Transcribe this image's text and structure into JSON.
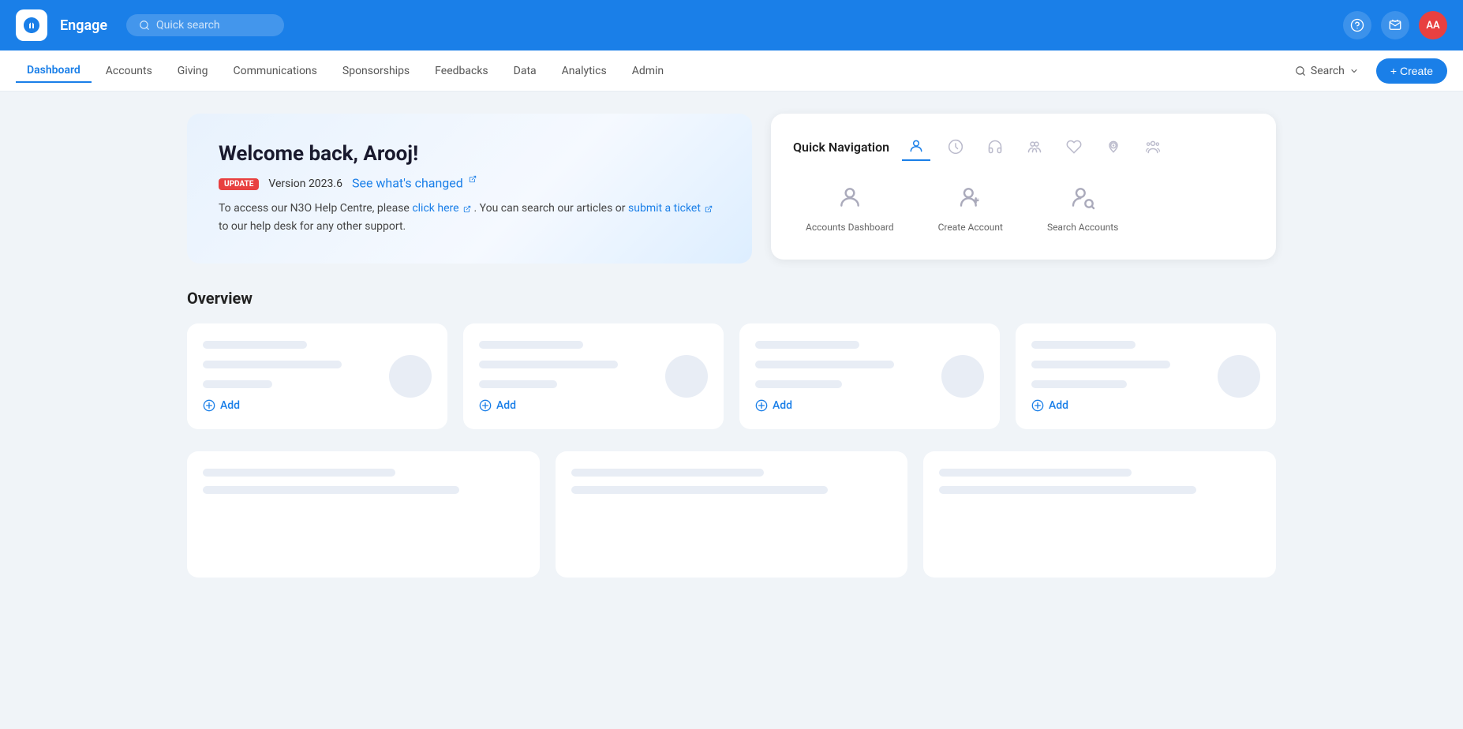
{
  "topbar": {
    "logo_label": "Engage",
    "search_placeholder": "Quick search",
    "avatar_initials": "AA",
    "help_icon": "?",
    "check_icon": "✓"
  },
  "navbar": {
    "items": [
      {
        "label": "Dashboard",
        "active": true
      },
      {
        "label": "Accounts",
        "active": false
      },
      {
        "label": "Giving",
        "active": false
      },
      {
        "label": "Communications",
        "active": false
      },
      {
        "label": "Sponsorships",
        "active": false
      },
      {
        "label": "Feedbacks",
        "active": false
      },
      {
        "label": "Data",
        "active": false
      },
      {
        "label": "Analytics",
        "active": false
      },
      {
        "label": "Admin",
        "active": false
      }
    ],
    "search_label": "Search",
    "create_label": "+ Create"
  },
  "welcome": {
    "greeting_prefix": "Welcome back, ",
    "username": "Arooj!",
    "badge_label": "UPDATE",
    "version": "Version 2023.6",
    "see_whats_changed": "See what's changed",
    "help_text": "To access our N3O Help Centre, please ",
    "click_here": "click here",
    "help_text2": ". You can search our articles or ",
    "submit_ticket": "submit a ticket",
    "help_text3": " to our help desk for any other support."
  },
  "quick_nav": {
    "title": "Quick Navigation",
    "active_icon": "accounts",
    "icons": [
      {
        "name": "accounts-icon",
        "symbol": "👤"
      },
      {
        "name": "chart-icon",
        "symbol": "📊"
      },
      {
        "name": "headset-icon",
        "symbol": "🎧"
      },
      {
        "name": "group-icon",
        "symbol": "👥"
      },
      {
        "name": "heart-icon",
        "symbol": "♡"
      },
      {
        "name": "location-icon",
        "symbol": "◎"
      },
      {
        "name": "people-icon",
        "symbol": "👨‍👩‍👧"
      }
    ],
    "items": [
      {
        "name": "accounts-dashboard-item",
        "label": "Accounts Dashboard",
        "icon": "person"
      },
      {
        "name": "create-account-item",
        "label": "Create Account",
        "icon": "person-add"
      },
      {
        "name": "search-accounts-item",
        "label": "Search Accounts",
        "icon": "person-search"
      }
    ]
  },
  "overview": {
    "title": "Overview",
    "cards": [
      {
        "id": "card-1",
        "add_label": "Add"
      },
      {
        "id": "card-2",
        "add_label": "Add"
      },
      {
        "id": "card-3",
        "add_label": "Add"
      },
      {
        "id": "card-4",
        "add_label": "Add"
      }
    ],
    "row2_cards": [
      {
        "id": "card-r2-1"
      },
      {
        "id": "card-r2-2"
      },
      {
        "id": "card-r2-3"
      }
    ]
  },
  "colors": {
    "brand_blue": "#1a7fe8",
    "danger_red": "#e84040",
    "nav_bg": "#ffffff",
    "topbar_bg": "#1a7fe8"
  }
}
